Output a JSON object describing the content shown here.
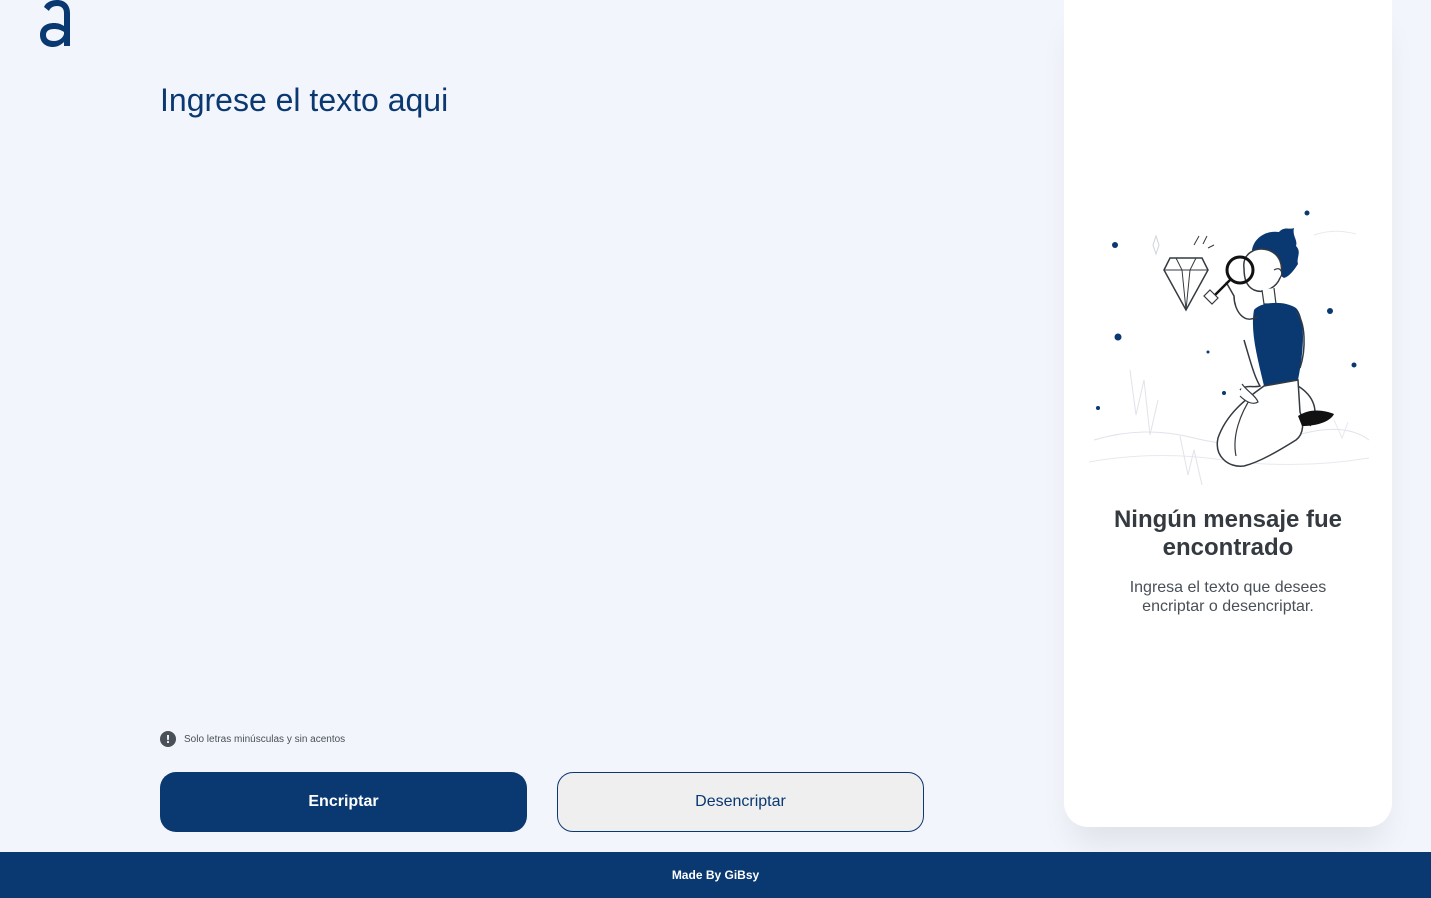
{
  "logo": {
    "icon": "alura-a-logo",
    "color": "#0a3871"
  },
  "input": {
    "placeholder": "Ingrese el texto aqui",
    "value": ""
  },
  "hint": {
    "icon": "exclamation-circle-icon",
    "text": "Solo letras minúsculas y sin acentos"
  },
  "buttons": {
    "encrypt_label": "Encriptar",
    "decrypt_label": "Desencriptar"
  },
  "output_panel": {
    "illustration": "person-with-magnifying-glass-and-diamond",
    "title": "Ningún mensaje fue encontrado",
    "message": "Ingresa el texto que desees encriptar o desencriptar."
  },
  "footer": {
    "text": "Made By GiBsy"
  },
  "colors": {
    "primary": "#0a3871",
    "background": "#f3f5fc",
    "card": "#ffffff",
    "secondary_button": "#efefef"
  }
}
